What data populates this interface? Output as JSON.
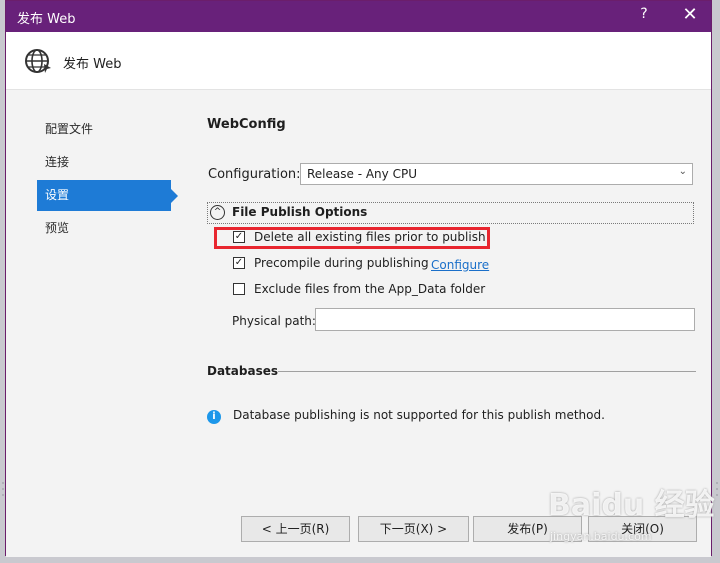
{
  "window": {
    "title": "发布 Web",
    "help_label": "?",
    "close_label": "✕"
  },
  "header": {
    "icon": "globe-publish-icon",
    "title": "发布 Web"
  },
  "nav": {
    "items": [
      {
        "label": "配置文件",
        "active": false
      },
      {
        "label": "连接",
        "active": false
      },
      {
        "label": "设置",
        "active": true
      },
      {
        "label": "预览",
        "active": false
      }
    ]
  },
  "settings": {
    "section_title": "WebConfig",
    "configuration_label": "Configuration:",
    "configuration_value": "Release - Any CPU",
    "file_publish_options": {
      "title": "File Publish Options",
      "options": [
        {
          "label": "Delete all existing files prior to publish",
          "checked": true
        },
        {
          "label": "Precompile during publishing",
          "checked": true
        },
        {
          "label": "Exclude files from the App_Data folder",
          "checked": false
        }
      ],
      "configure_link": "Configure",
      "physical_path_label": "Physical path:",
      "physical_path_value": ""
    },
    "databases": {
      "title": "Databases",
      "info": "Database publishing is not supported for this publish method."
    }
  },
  "buttons": {
    "prev": "< 上一页(R)",
    "next": "下一页(X) >",
    "publish": "发布(P)",
    "close": "关闭(O)"
  },
  "watermark": {
    "main": "Baidu 经验",
    "sub": "jingyan.baidu.com"
  },
  "colors": {
    "titlebar": "#68217a",
    "accent": "#1e7bd6",
    "highlight": "#e8262f"
  }
}
